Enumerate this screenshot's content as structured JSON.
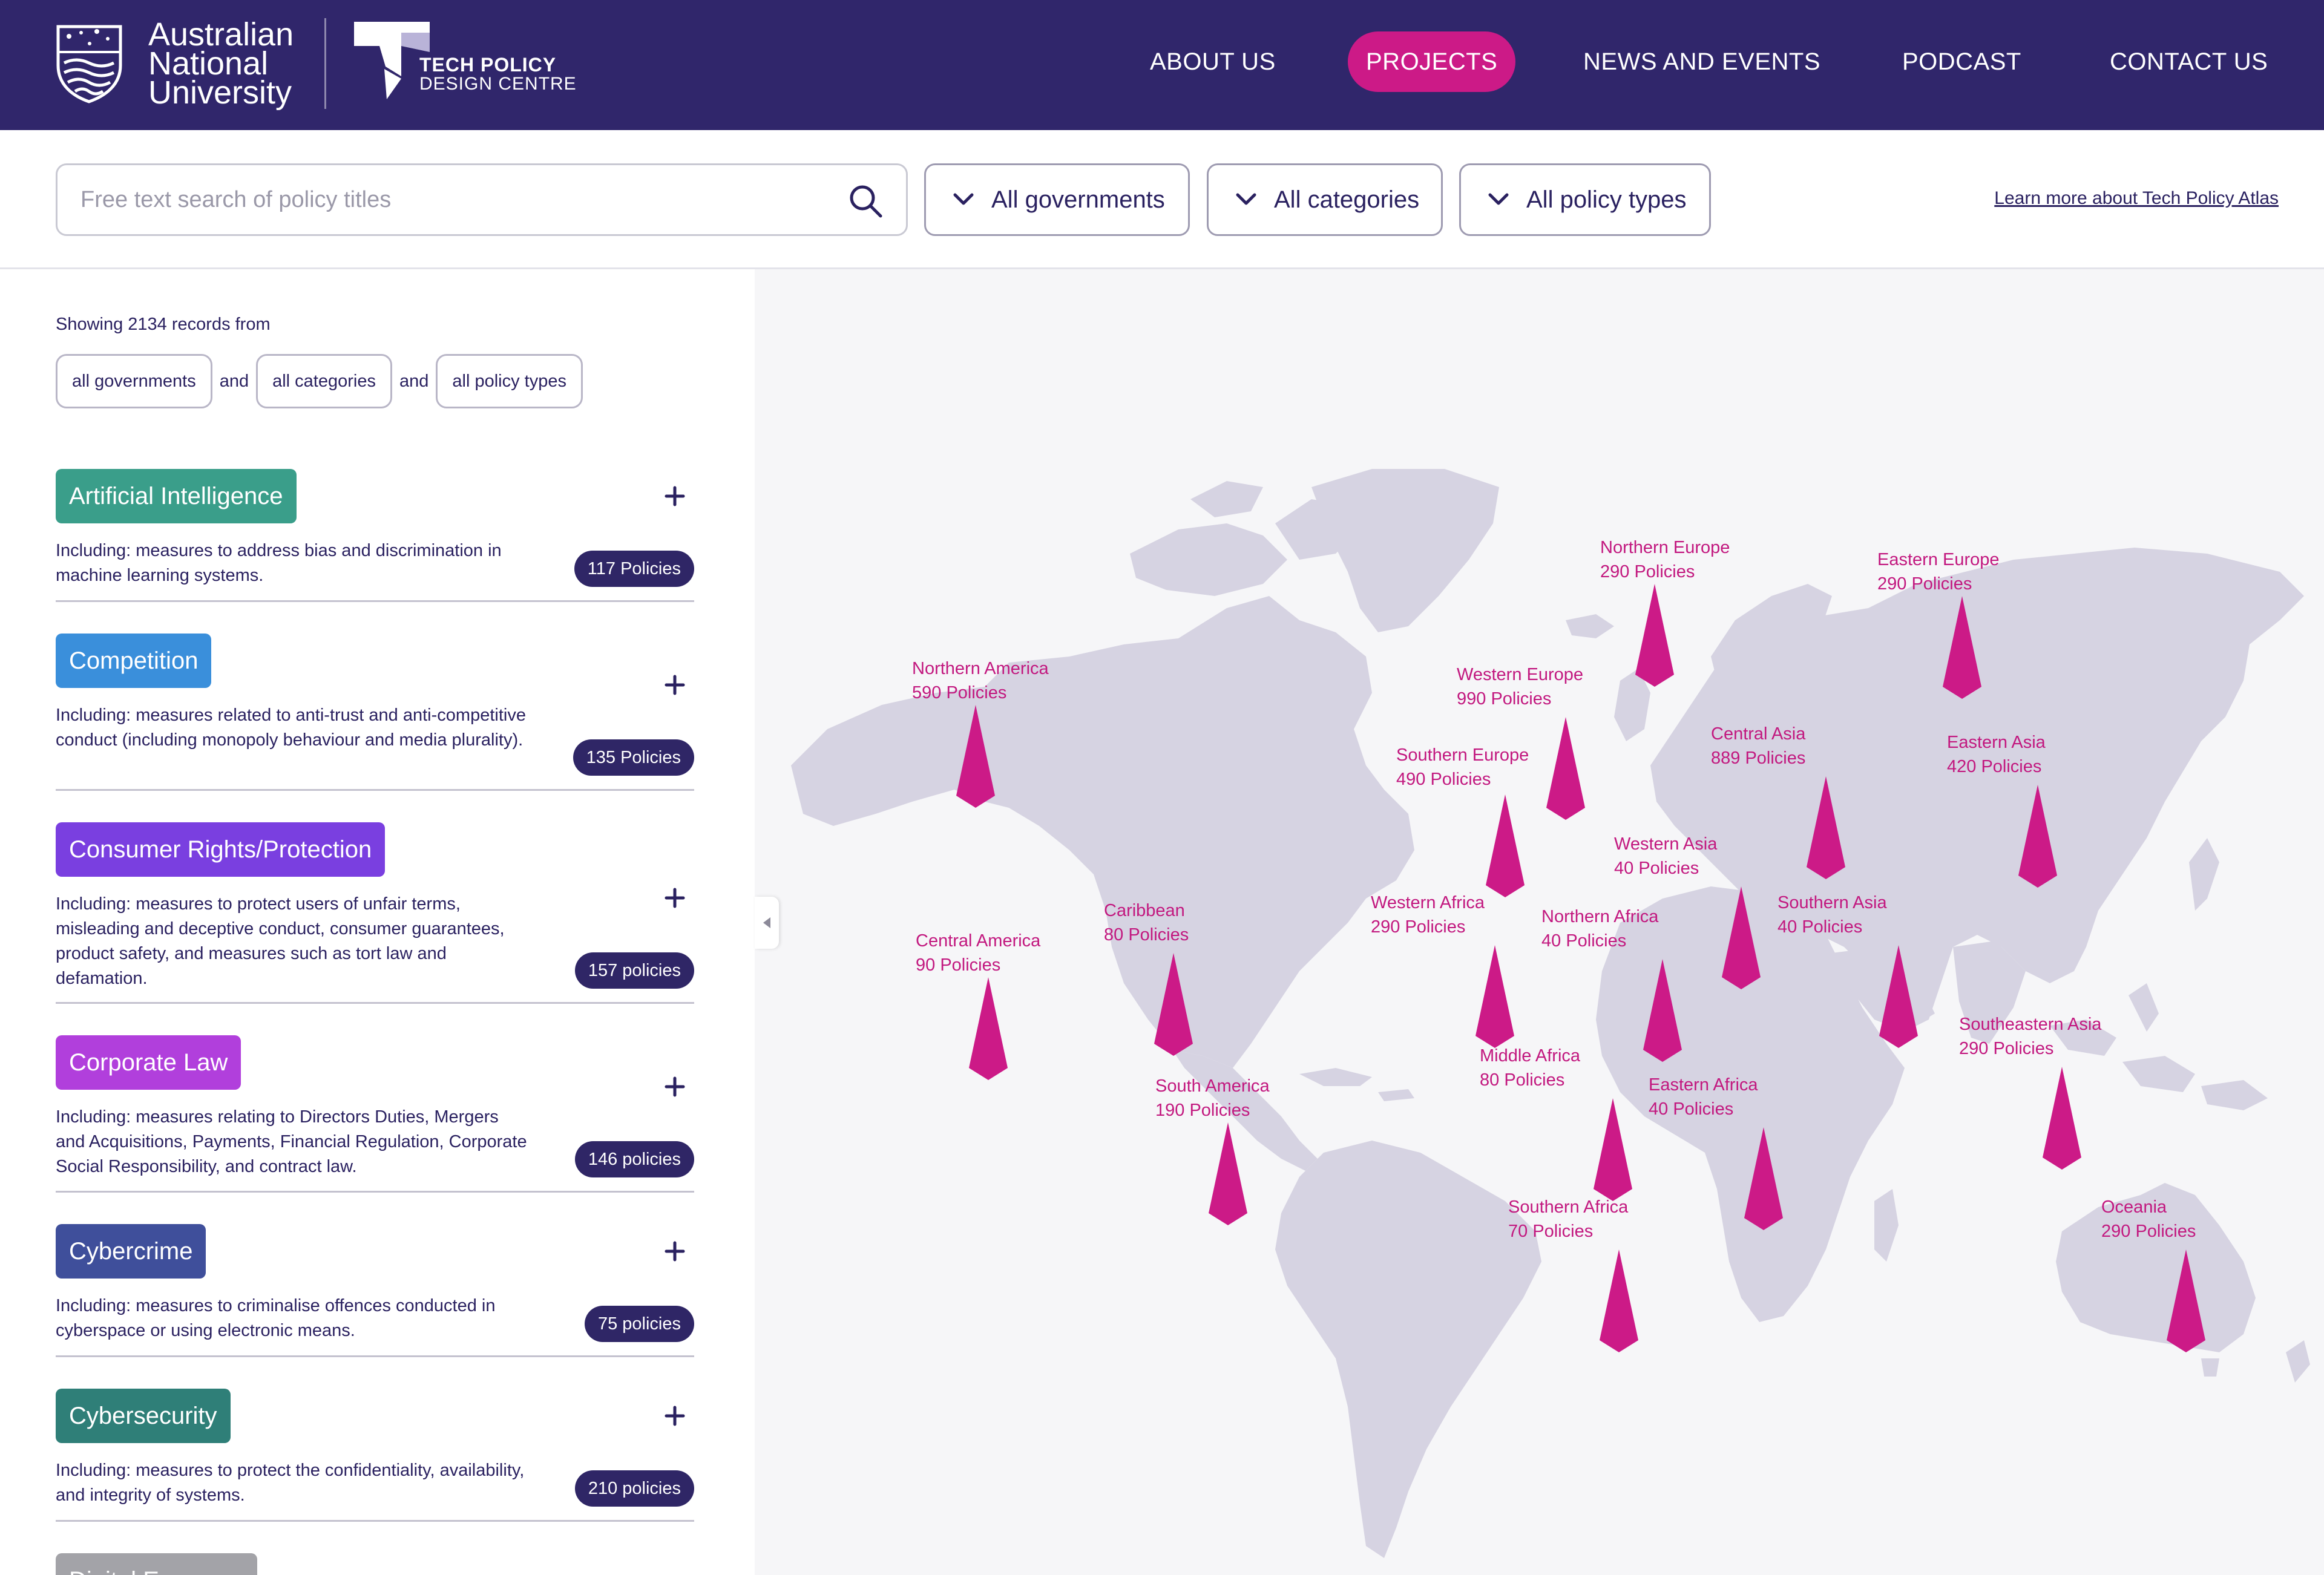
{
  "header": {
    "anu_lines": [
      "Australian",
      "National",
      "University"
    ],
    "tpdc_line1": "TECH POLICY",
    "tpdc_line2": "DESIGN CENTRE",
    "nav": [
      {
        "label": "ABOUT US",
        "active": false
      },
      {
        "label": "PROJECTS",
        "active": true
      },
      {
        "label": "NEWS AND EVENTS",
        "active": false
      },
      {
        "label": "PODCAST",
        "active": false
      },
      {
        "label": "CONTACT US",
        "active": false
      }
    ]
  },
  "filters": {
    "search_placeholder": "Free text search of policy titles",
    "governments": "All governments",
    "categories": "All categories",
    "policy_types": "All policy types",
    "learn_more": "Learn more about Tech Policy Atlas"
  },
  "summary": {
    "showing": "Showing 2134 records from",
    "chip_governments": "all governments",
    "chip_categories": "all categories",
    "chip_types": "all policy types",
    "and": "and"
  },
  "categories": [
    {
      "title": "Artificial Intelligence",
      "color": "#3a9e8a",
      "desc": "Including: measures to address bias and discrimination in machine learning systems.",
      "count": "117 Policies"
    },
    {
      "title": "Competition",
      "color": "#3a8fdb",
      "desc": "Including: measures related to anti-trust and anti-competitive conduct (including monopoly behaviour and media plurality).",
      "count": "135 Policies"
    },
    {
      "title": "Consumer Rights/Protection",
      "color": "#7a3fe0",
      "desc": "Including: measures to protect users of unfair terms, misleading and deceptive conduct, consumer guarantees, product safety, and measures such as tort law and defamation.",
      "count": "157 policies"
    },
    {
      "title": "Corporate Law",
      "color": "#b13fdc",
      "desc": "Including: measures relating to Directors Duties, Mergers and Acquisitions, Payments, Financial Regulation, Corporate Social Responsibility, and contract law.",
      "count": "146 policies"
    },
    {
      "title": "Cybercrime",
      "color": "#3f4f9b",
      "desc": "Including: measures to criminalise offences conducted in cyberspace or using electronic means.",
      "count": "75 policies"
    },
    {
      "title": "Cybersecurity",
      "color": "#2f7f78",
      "desc": "Including: measures to protect the confidentiality, availability, and integrity of systems.",
      "count": "210 policies"
    },
    {
      "title": "Digital Economy",
      "color": "#a3a3a8",
      "desc": "",
      "count": ""
    }
  ],
  "regions": [
    {
      "name": "Northern America",
      "count": "590 Policies"
    },
    {
      "name": "Central America",
      "count": "90 Policies"
    },
    {
      "name": "Caribbean",
      "count": "80 Policies"
    },
    {
      "name": "South America",
      "count": "190 Policies"
    },
    {
      "name": "Northern Europe",
      "count": "290 Policies"
    },
    {
      "name": "Western Europe",
      "count": "990 Policies"
    },
    {
      "name": "Southern Europe",
      "count": "490 Policies"
    },
    {
      "name": "Eastern Europe",
      "count": "290 Policies"
    },
    {
      "name": "Central Asia",
      "count": "889 Policies"
    },
    {
      "name": "Eastern  Asia",
      "count": "420 Policies"
    },
    {
      "name": "Western Asia",
      "count": "40 Policies"
    },
    {
      "name": "Southern Asia",
      "count": "40 Policies"
    },
    {
      "name": "Southeastern Asia",
      "count": "290 Policies"
    },
    {
      "name": "Western Africa",
      "count": "290 Policies"
    },
    {
      "name": "Northern Africa",
      "count": "40 Policies"
    },
    {
      "name": "Middle Africa",
      "count": "80 Policies"
    },
    {
      "name": "Eastern Africa",
      "count": "40 Policies"
    },
    {
      "name": "Southern Africa",
      "count": "70 Policies"
    },
    {
      "name": "Oceania",
      "count": "290 Policies"
    }
  ],
  "colors": {
    "header_bg": "#30266b",
    "accent": "#cc1a87",
    "map_land": "#d6d3e2",
    "count_badge": "#2f2666"
  }
}
